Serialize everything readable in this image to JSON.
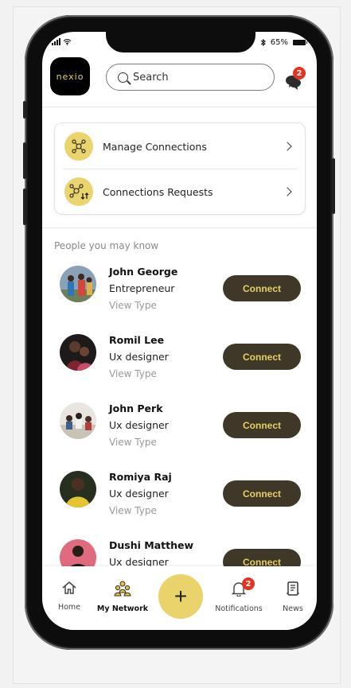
{
  "status_bar": {
    "battery": "65%"
  },
  "header": {
    "logo_text": "nexio",
    "search_placeholder": "Search",
    "chat_badge": "2"
  },
  "network_menu": [
    {
      "label": "Manage Connections",
      "icon": "people-network-icon"
    },
    {
      "label": "Connections Requests",
      "icon": "connection-requests-icon"
    }
  ],
  "section_title": "People you may know",
  "people": [
    {
      "name": "John George",
      "role": "Entrepreneur",
      "sub": "View Type",
      "action": "Connect"
    },
    {
      "name": "Romil Lee",
      "role": "Ux designer",
      "sub": "View Type",
      "action": "Connect"
    },
    {
      "name": "John Perk",
      "role": "Ux designer",
      "sub": "View Type",
      "action": "Connect"
    },
    {
      "name": "Romiya Raj",
      "role": "Ux designer",
      "sub": "View Type",
      "action": "Connect"
    },
    {
      "name": "Dushi Matthew",
      "role": "Ux designer",
      "sub": "",
      "action": "Connect"
    }
  ],
  "tabbar": {
    "home": "Home",
    "network": "My Network",
    "add": "+",
    "notifications": "Notifications",
    "notifications_badge": "2",
    "news": "News"
  },
  "colors": {
    "accent": "#E9D46E",
    "button_dark": "#3F3828",
    "button_text": "#E6CF5F",
    "badge": "#E53323"
  }
}
